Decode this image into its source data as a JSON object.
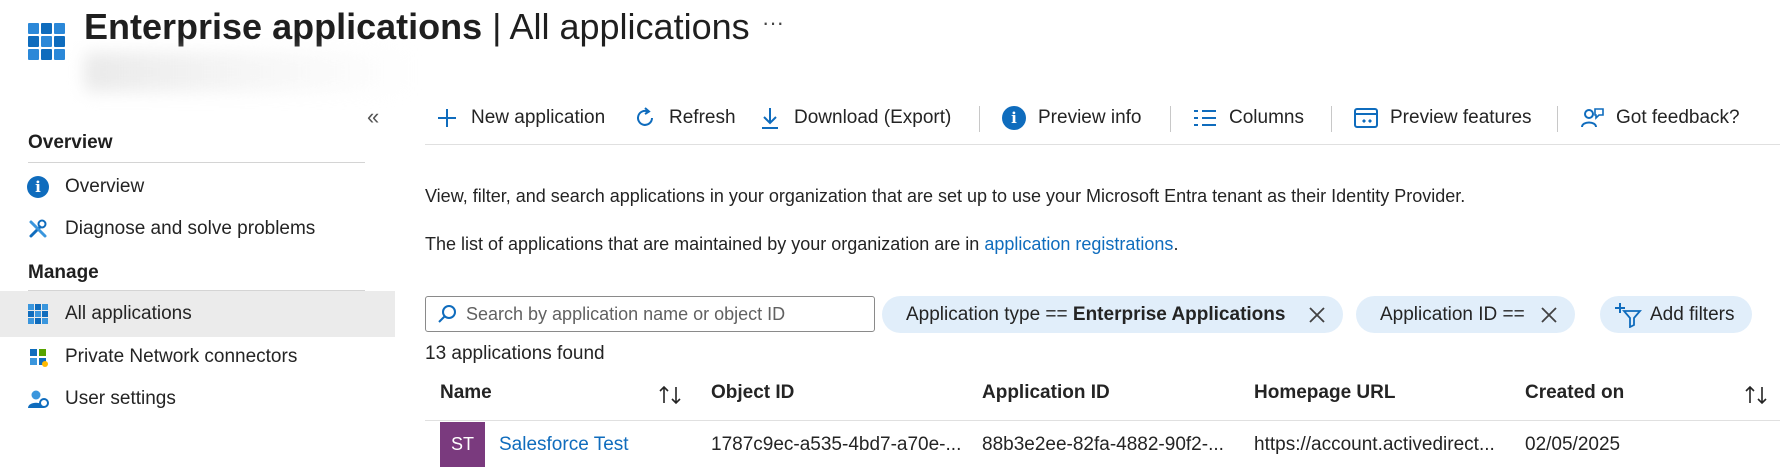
{
  "header": {
    "title_bold": "Enterprise applications",
    "title_rest": " | All applications",
    "more": "···"
  },
  "sidebar": {
    "collapse": "«",
    "sections": [
      {
        "title": "Overview",
        "items": [
          {
            "label": "Overview",
            "icon": "info-icon"
          },
          {
            "label": "Diagnose and solve problems",
            "icon": "wrench-icon"
          }
        ]
      },
      {
        "title": "Manage",
        "items": [
          {
            "label": "All applications",
            "icon": "grid-icon",
            "active": true
          },
          {
            "label": "Private Network connectors",
            "icon": "connector-icon"
          },
          {
            "label": "User settings",
            "icon": "user-settings-icon"
          }
        ]
      }
    ]
  },
  "toolbar": {
    "new_application": "New application",
    "refresh": "Refresh",
    "download": "Download (Export)",
    "preview_info": "Preview info",
    "columns": "Columns",
    "preview_features": "Preview features",
    "feedback": "Got feedback?"
  },
  "main": {
    "description1": "View, filter, and search applications in your organization that are set up to use your Microsoft Entra tenant as their Identity Provider.",
    "description2_prefix": "The list of applications that are maintained by your organization are in ",
    "description2_link": "application registrations",
    "description2_suffix": ".",
    "search_placeholder": "Search by application name or object ID",
    "filters": {
      "app_type_label": "Application type == ",
      "app_type_value": "Enterprise Applications",
      "app_id_label": "Application ID == ",
      "add_filters": "Add filters"
    },
    "count": "13 applications found",
    "table": {
      "columns": [
        "Name",
        "Object ID",
        "Application ID",
        "Homepage URL",
        "Created on"
      ],
      "rows": [
        {
          "initials": "ST",
          "name": "Salesforce Test",
          "object_id": "1787c9ec-a535-4bd7-a70e-...",
          "application_id": "88b3e2ee-82fa-4882-90f2-...",
          "homepage_url": "https://account.activedirect...",
          "created_on": "02/05/2025"
        }
      ]
    }
  },
  "colors": {
    "accent": "#0f6cbd",
    "pill_bg": "#e1eefa",
    "avatar_bg": "#7a3a7e",
    "active_nav_bg": "#ebebeb"
  }
}
